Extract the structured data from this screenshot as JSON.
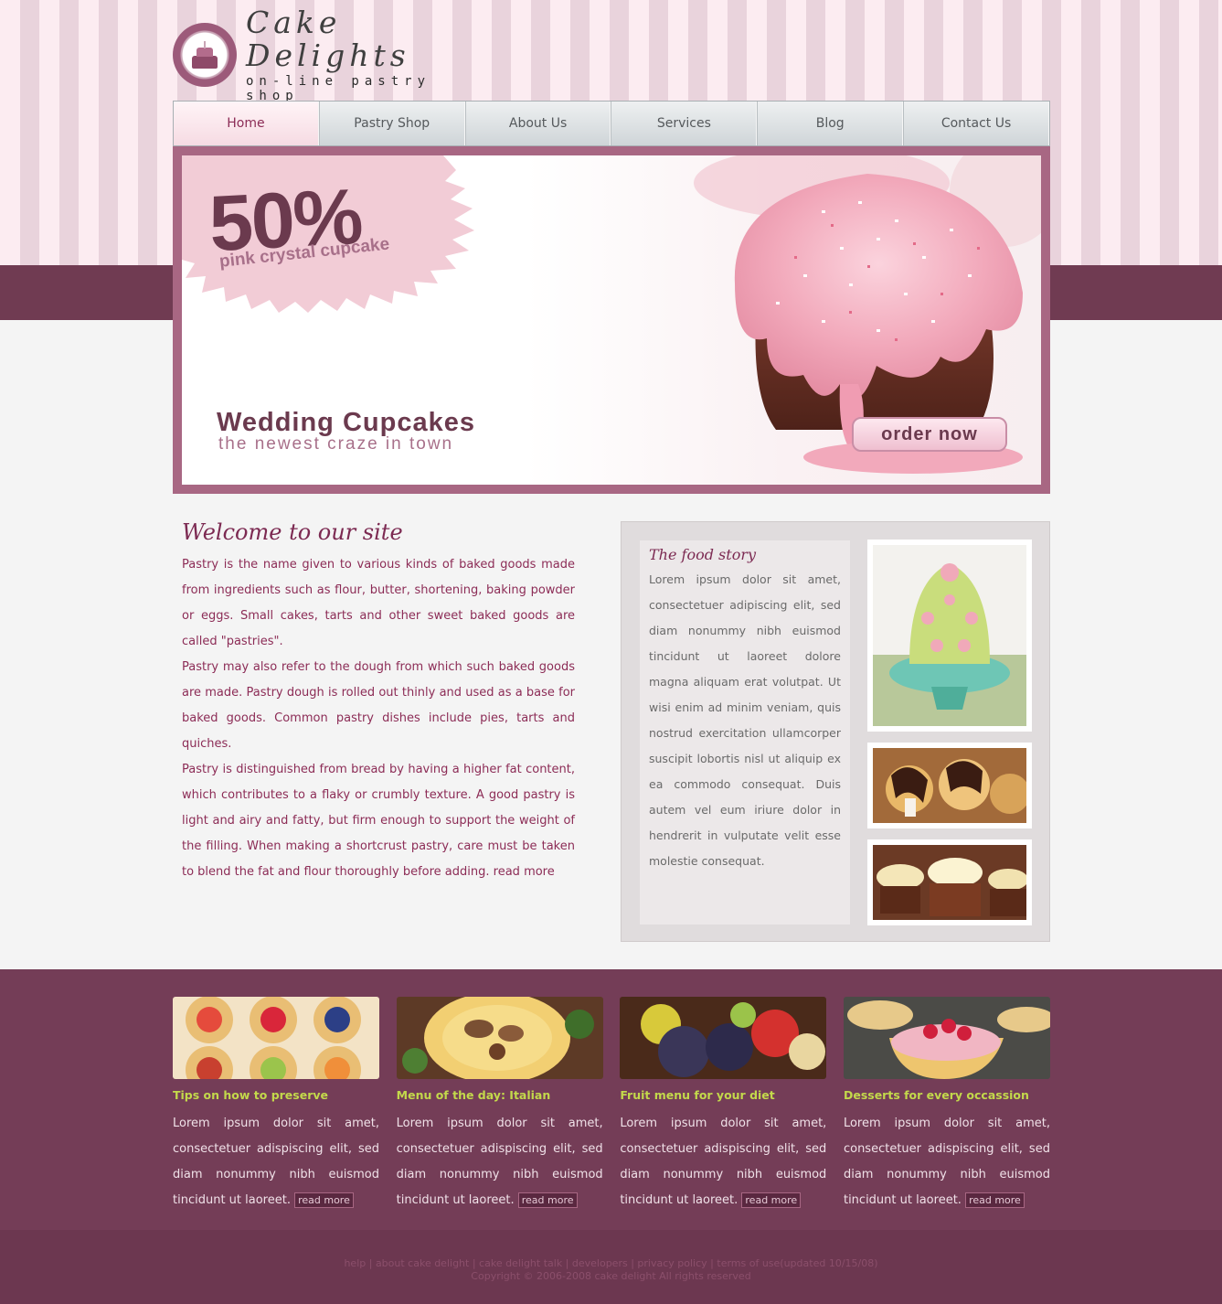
{
  "brand": {
    "title": "Cake Delights",
    "subtitle": "on-line pastry shop"
  },
  "nav": {
    "items": [
      {
        "label": "Home",
        "active": true
      },
      {
        "label": "Pastry Shop",
        "active": false
      },
      {
        "label": "About Us",
        "active": false
      },
      {
        "label": "Services",
        "active": false
      },
      {
        "label": "Blog",
        "active": false
      },
      {
        "label": "Contact Us",
        "active": false
      }
    ]
  },
  "banner": {
    "promo_percent": "50%",
    "promo_label": "pink crystal cupcake",
    "title": "Wedding Cupcakes",
    "subtitle": "the newest craze in town",
    "cta_label": "order now"
  },
  "welcome": {
    "heading": "Welcome to our site",
    "paragraphs": [
      "Pastry is the name given to various kinds of baked goods made from ingredients such as flour, butter, shortening, baking powder or eggs. Small cakes, tarts and other sweet baked goods are called \"pastries\".",
      "Pastry may also refer to the dough from which such baked goods are made. Pastry dough is rolled out thinly and used as a base for baked goods. Common pastry dishes include pies, tarts and quiches.",
      "Pastry is distinguished from bread by having a higher fat content, which contributes to a flaky or crumbly texture. A good pastry is light and airy and fatty, but firm enough to support the weight of the filling. When making a shortcrust pastry, care must be taken to blend the fat and flour thoroughly before adding."
    ],
    "read_more": "read more"
  },
  "story": {
    "heading": "The food story",
    "body": "Lorem ipsum dolor sit amet, consectetuer adipiscing elit, sed diam nonummy nibh euismod tincidunt ut laoreet dolore magna aliquam erat volutpat. Ut wisi enim ad minim veniam, quis nostrud exercitation ullamcorper suscipit lobortis nisl ut aliquip ex ea commodo consequat. Duis autem vel eum iriure dolor in hendrerit in vulputate velit esse molestie consequat."
  },
  "cards": [
    {
      "title": "Tips on how to preserve",
      "body": "Lorem ipsum dolor sit amet, consectetuer adispiscing elit, sed diam nonummy nibh euismod tincidunt ut laoreet.",
      "read_more": "read more"
    },
    {
      "title": "Menu of the day: Italian",
      "body": "Lorem ipsum dolor sit amet, consectetuer adispiscing elit, sed diam nonummy nibh euismod tincidunt ut laoreet.",
      "read_more": "read more"
    },
    {
      "title": "Fruit menu for your diet",
      "body": "Lorem ipsum dolor sit amet, consectetuer adispiscing elit, sed diam nonummy nibh euismod tincidunt ut laoreet.",
      "read_more": "read more"
    },
    {
      "title": "Desserts for every occassion",
      "body": "Lorem ipsum dolor sit amet, consectetuer adispiscing elit, sed diam nonummy nibh euismod tincidunt ut laoreet.",
      "read_more": "read more"
    }
  ],
  "footer": {
    "links": [
      "help",
      "about cake delight",
      "cake delight talk",
      "developers",
      "privacy policy",
      "terms of use(updated 10/15/08)"
    ],
    "copyright": "Copyright © 2006-2008 cake delight All rights reserved"
  },
  "colors": {
    "plum": "#703b52",
    "accent": "#8c2c56",
    "card_title": "#c3d94b",
    "stripe_light": "#fcecf1",
    "stripe_dark": "#e9d3dc"
  }
}
